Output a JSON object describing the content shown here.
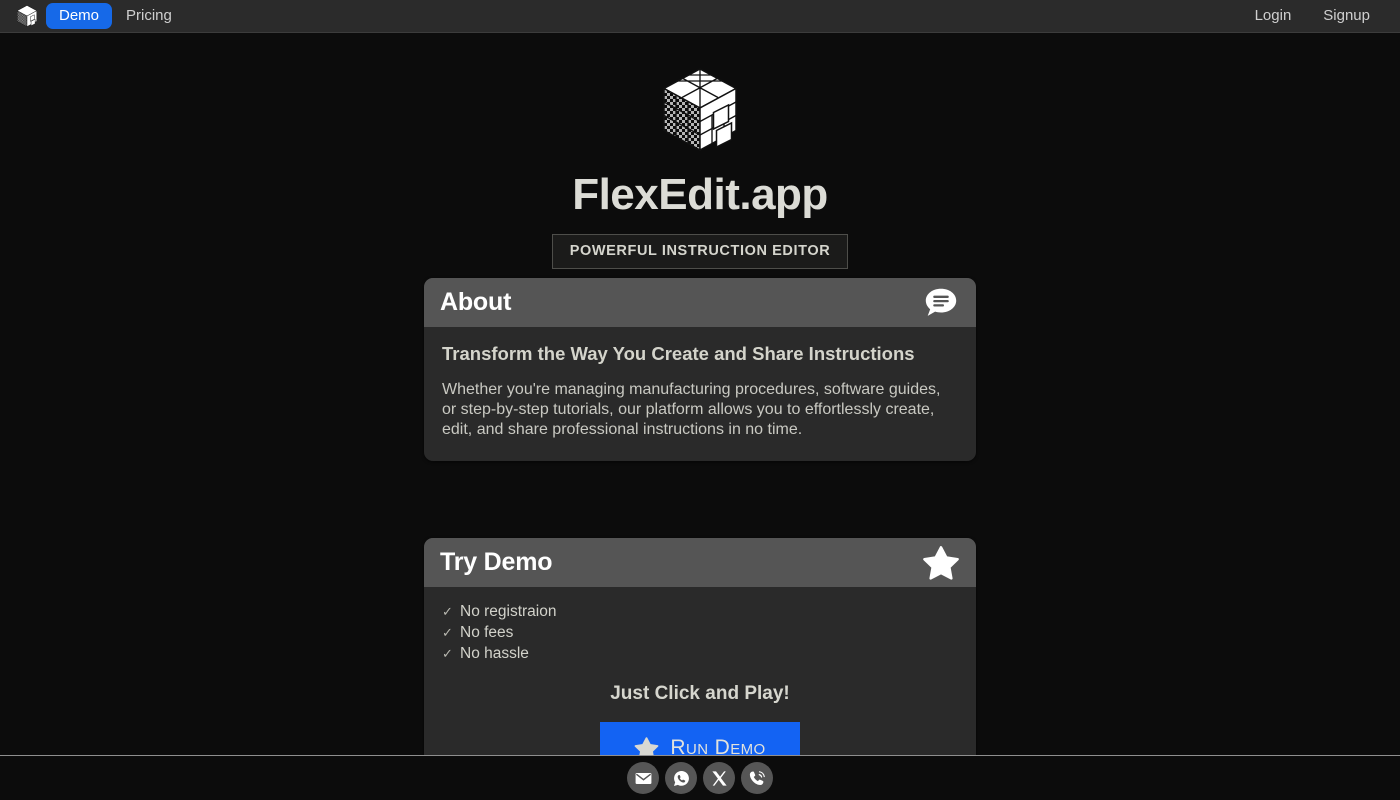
{
  "navbar": {
    "logo_icon": "cube-logo-icon",
    "items": [
      {
        "label": "Demo",
        "active": true
      },
      {
        "label": "Pricing",
        "active": false
      }
    ],
    "account": [
      {
        "label": "Login"
      },
      {
        "label": "Signup"
      }
    ],
    "accent_color": "#1669e8",
    "background_color": "#2b2b2b"
  },
  "hero": {
    "logo_icon": "cube-logo-icon",
    "title": "FlexEdit.app",
    "badge": "POWERFUL INSTRUCTION EDITOR",
    "title_color": "#dcdcd6"
  },
  "about_card": {
    "title": "About",
    "icon": "chat-bubble-icon",
    "heading": "Transform the Way You Create and Share Instructions",
    "body": "Whether you're managing manufacturing procedures, software guides, or step-by-step tutorials, our platform allows you to effortlessly create, edit, and share professional instructions in no time.",
    "header_color": "#555555",
    "body_color": "#2a2a2a"
  },
  "demo_card": {
    "title": "Try Demo",
    "icon": "star-icon",
    "features": [
      {
        "check": "✓",
        "label": "No registraion"
      },
      {
        "check": "✓",
        "label": "No fees"
      },
      {
        "check": "✓",
        "label": "No hassle"
      }
    ],
    "cta_text": "Just Click and Play!",
    "button_label": "Run Demo",
    "button_icon": "star-icon",
    "button_color": "#1363f3"
  },
  "footer": {
    "social": [
      {
        "name": "email-icon",
        "label": "Email"
      },
      {
        "name": "whatsapp-icon",
        "label": "WhatsApp"
      },
      {
        "name": "x-twitter-icon",
        "label": "X"
      },
      {
        "name": "phone-icon",
        "label": "Phone"
      }
    ],
    "circle_color": "#565656"
  }
}
